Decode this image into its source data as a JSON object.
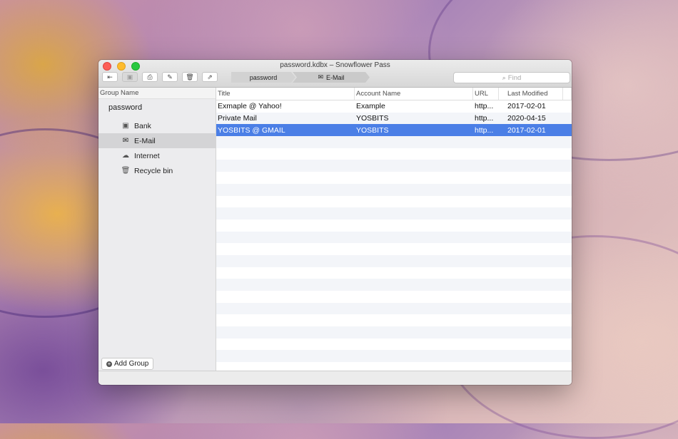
{
  "window": {
    "title": "password.kdbx – Snowflower Pass"
  },
  "toolbar": {
    "buttons": [
      {
        "name": "sign-out-icon",
        "glyph": "⇤"
      },
      {
        "name": "new-entry-icon",
        "glyph": "▣"
      },
      {
        "name": "print-icon",
        "glyph": "⎙"
      },
      {
        "name": "edit-icon",
        "glyph": "✎"
      },
      {
        "name": "trash-icon",
        "glyph": "🗑"
      },
      {
        "name": "open-url-icon",
        "glyph": "⇗"
      }
    ]
  },
  "path": {
    "root": "password",
    "current": "E-Mail"
  },
  "search": {
    "placeholder": "Find"
  },
  "sidebar": {
    "header": "Group Name",
    "root": "password",
    "items": [
      {
        "label": "Bank",
        "icon": "banknote-icon"
      },
      {
        "label": "E-Mail",
        "icon": "envelope-icon",
        "selected": true
      },
      {
        "label": "Internet",
        "icon": "cloud-icon"
      },
      {
        "label": "Recycle bin",
        "icon": "trash-icon"
      }
    ],
    "add_group": "Add Group"
  },
  "table": {
    "columns": [
      "Title",
      "Account Name",
      "URL",
      "Last Modified"
    ],
    "rows": [
      {
        "title": "Exmaple @  Yahoo!",
        "account": "Example",
        "url": "http...",
        "modified": "2017-02-01"
      },
      {
        "title": "Private Mail",
        "account": "YOSBITS",
        "url": "http...",
        "modified": "2020-04-15"
      },
      {
        "title": "YOSBITS @ GMAIL",
        "account": "YOSBITS",
        "url": "http...",
        "modified": "2017-02-01",
        "selected": true
      }
    ]
  },
  "colors": {
    "selection": "#4b7fe6",
    "sidebar_selected": "#d4d4d6"
  }
}
